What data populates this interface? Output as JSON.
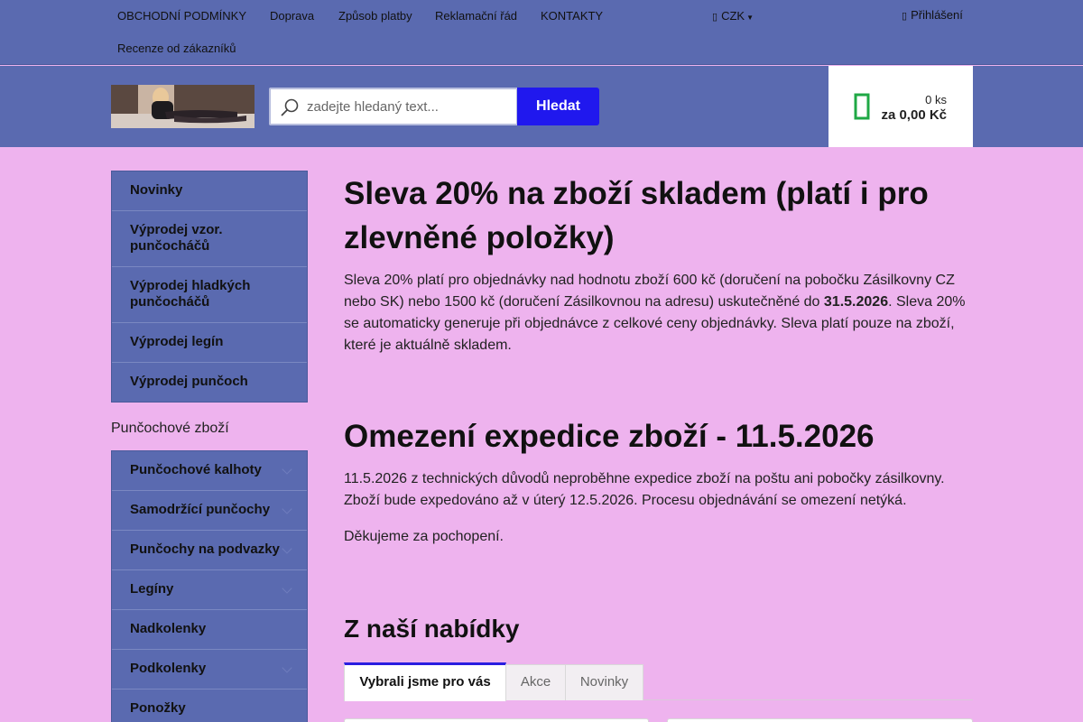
{
  "top_nav": {
    "links": [
      "OBCHODNÍ PODMÍNKY",
      "Doprava",
      "Způsob platby",
      "Reklamační řád",
      "KONTAKTY",
      "Recenze od zákazníků"
    ],
    "currency": "CZK",
    "login": "Přihlášení"
  },
  "header": {
    "search_placeholder": "zadejte hledaný text...",
    "search_button": "Hledat",
    "cart_qty": "0 ks",
    "cart_price": "za 0,00 Kč"
  },
  "sidebar": {
    "top_items": [
      "Novinky",
      "Výprodej vzor. punčocháčů",
      "Výprodej hladkých punčocháčů",
      "Výprodej legín",
      "Výprodej punčoch"
    ],
    "section_title": "Punčochové zboží",
    "category_items": [
      "Punčochové kalhoty",
      "Samodržící punčochy",
      "Punčochy na podvazky",
      "Legíny",
      "Nadkolenky",
      "Podkolenky",
      "Ponožky"
    ]
  },
  "content": {
    "sale_title": "Sleva 20% na zboží skladem (platí i pro zlevněné položky)",
    "sale_text_before": "Sleva 20% platí pro objednávky nad hodnotu zboží 600 kč (doručení na pobočku Zásilkovny CZ nebo SK) nebo 1500 kč (doručení Zásilkovnou na adresu) uskutečněné do ",
    "sale_date": "31.5.2026",
    "sale_text_after": ". Sleva 20% se automaticky generuje při objednávce z celkové ceny objednávky. Sleva platí pouze na zboží, které je aktuálně skladem.",
    "notice_title": "Omezení expedice zboží - 11.5.2026",
    "notice_text": "11.5.2026 z technických důvodů neproběhne expedice zboží na poštu ani pobočky zásilkovny. Zboží bude expedováno až v úterý 12.5.2026. Procesu objednávání se omezení netýká.",
    "thanks": "Děkujeme za pochopení.",
    "offer_title": "Z naší nabídky",
    "tabs": [
      "Vybrali jsme pro vás",
      "Akce",
      "Novinky"
    ]
  }
}
